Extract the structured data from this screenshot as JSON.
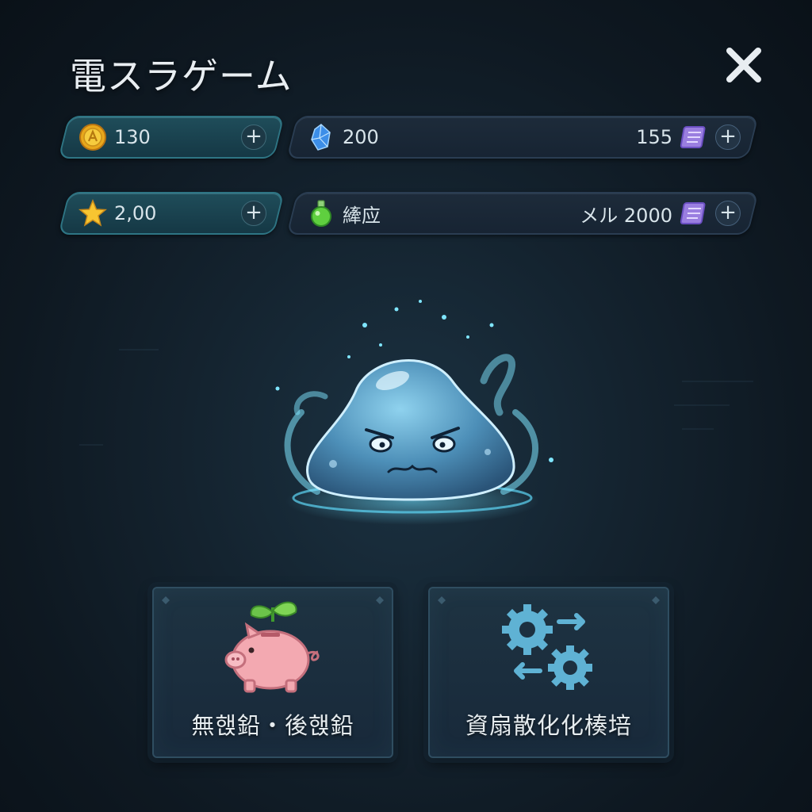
{
  "window": {
    "title": "電スラゲーム",
    "close_icon": "close-icon"
  },
  "resources": {
    "coins": {
      "value": "130",
      "icon": "gold-coin-icon"
    },
    "crystals": {
      "value": "200",
      "icon": "blue-crystal-icon",
      "right_value": "155",
      "right_icon": "scroll-icon"
    },
    "stars": {
      "value": "2,00",
      "icon": "star-icon"
    },
    "potion": {
      "value": "縴应",
      "icon": "green-potion-icon",
      "right_value": "メル 2000",
      "right_icon": "scroll-icon"
    },
    "plus_label": "+"
  },
  "slime": {
    "icon": "blue-slime-icon"
  },
  "cards": [
    {
      "label": "無핹鉛・後핹鉛",
      "icon": "piggy-bank-sprout-icon"
    },
    {
      "label": "資扇散化化楱培",
      "icon": "gears-arrows-icon"
    }
  ],
  "colors": {
    "accent_teal": "#2e7584",
    "background": "#0f1b26",
    "slime": "#5fb8e0"
  }
}
